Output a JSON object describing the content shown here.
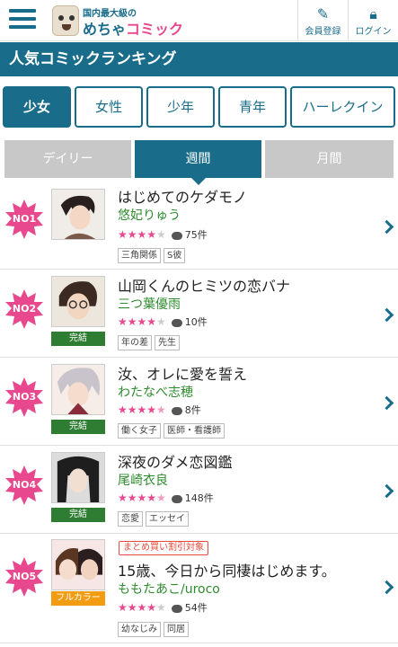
{
  "header": {
    "logo_tagline": "国内最大級の",
    "logo_part1": "めちゃ",
    "logo_part2": "コミック",
    "register_label": "会員登録",
    "login_label": "ログイン"
  },
  "page_title": "人気コミックランキング",
  "categories": [
    {
      "label": "少女",
      "active": true
    },
    {
      "label": "女性",
      "active": false
    },
    {
      "label": "少年",
      "active": false
    },
    {
      "label": "青年",
      "active": false
    },
    {
      "label": "ハーレクイン",
      "active": false
    }
  ],
  "periods": [
    {
      "label": "デイリー",
      "active": false
    },
    {
      "label": "週間",
      "active": true
    },
    {
      "label": "月間",
      "active": false
    }
  ],
  "colors": {
    "brand": "#1a6d8a",
    "badge": "#e8488e",
    "author": "#2e8b2e"
  },
  "ranking": [
    {
      "rank": "NO1",
      "title": "はじめてのケダモノ",
      "author": "悠妃りゅう",
      "rating": 4,
      "comments": "75件",
      "status": "",
      "promo": "",
      "tags": [
        "三角関係",
        "S彼"
      ]
    },
    {
      "rank": "NO2",
      "title": "山岡くんのヒミツの恋バナ",
      "author": "三つ葉優雨",
      "rating": 4,
      "comments": "10件",
      "status": "完結",
      "promo": "",
      "tags": [
        "年の差",
        "先生"
      ]
    },
    {
      "rank": "NO3",
      "title": "汝、オレに愛を誓え",
      "author": "わたなべ志穂",
      "rating": 4.5,
      "comments": "8件",
      "status": "完結",
      "promo": "",
      "tags": [
        "働く女子",
        "医師・看護師"
      ]
    },
    {
      "rank": "NO4",
      "title": "深夜のダメ恋図鑑",
      "author": "尾崎衣良",
      "rating": 4.5,
      "comments": "148件",
      "status": "完結",
      "promo": "",
      "tags": [
        "恋愛",
        "エッセイ"
      ]
    },
    {
      "rank": "NO5",
      "title": "15歳、今日から同棲はじめます。",
      "author": "ももたあこ/uroco",
      "rating": 4,
      "comments": "54件",
      "status": "フルカラー",
      "promo": "まとめ買い割引対象",
      "tags": [
        "幼なじみ",
        "同居"
      ]
    }
  ]
}
